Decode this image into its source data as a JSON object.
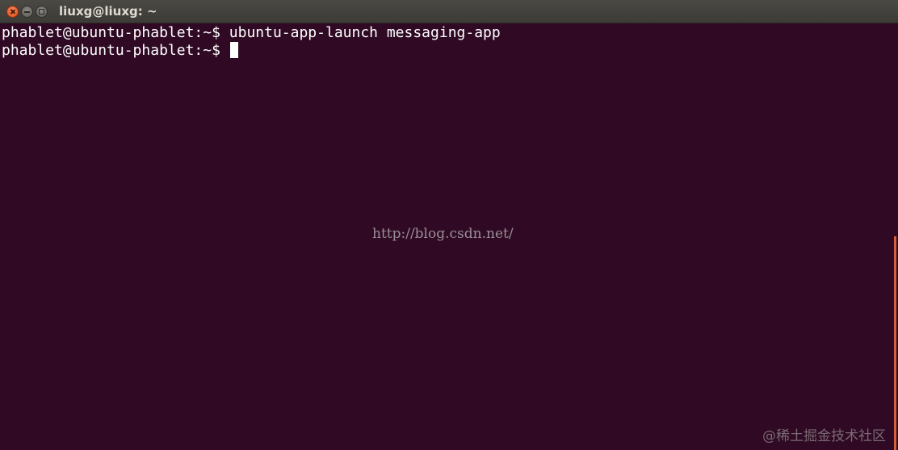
{
  "window": {
    "title": "liuxg@liuxg: ~"
  },
  "terminal": {
    "lines": [
      {
        "prompt": "phablet@ubuntu-phablet:~$",
        "command": " ubuntu-app-launch messaging-app"
      },
      {
        "prompt": "phablet@ubuntu-phablet:~$",
        "command": " "
      }
    ]
  },
  "watermarks": {
    "url": "http://blog.csdn.net/",
    "site": "@稀土掘金技术社区"
  },
  "colors": {
    "background": "#300a24",
    "text": "#ffffff",
    "titlebar": "#3c3b37",
    "close_button": "#e0531c",
    "scroll_indicator": "#d6613a"
  },
  "icons": {
    "close": "close-icon",
    "minimize": "minimize-icon",
    "maximize": "maximize-icon"
  }
}
